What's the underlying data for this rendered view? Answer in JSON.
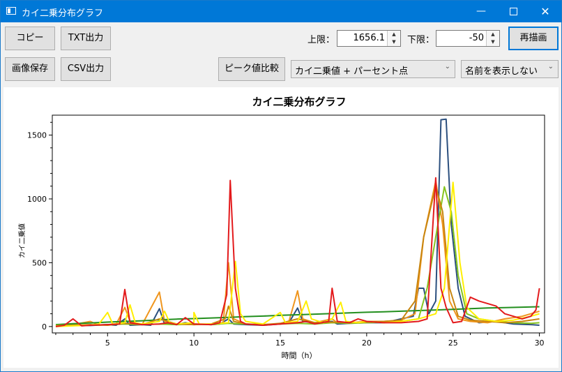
{
  "window": {
    "title": "カイ二乗分布グラフ",
    "minimize_glyph": "—",
    "close_glyph": "✕"
  },
  "toolbar": {
    "copy_label": "コピー",
    "txt_label": "TXT出力",
    "save_image_label": "画像保存",
    "csv_label": "CSV出力",
    "peak_compare_label": "ピーク値比較",
    "upper_label": "上限：",
    "upper_value": "1656.1",
    "lower_label": "下限：",
    "lower_value": "-50",
    "redraw_label": "再描画",
    "mode_select": "カイ二乗値 + パーセント点",
    "name_select": "名前を表示しない"
  },
  "colors": {
    "red": "#e31a1c",
    "orange": "#f0961e",
    "navy": "#2b4f7e",
    "yellow": "#ffef00",
    "green": "#238f1e",
    "darkorange": "#c8850f",
    "line_lime": "#86c41f",
    "accent": "#0078d7"
  },
  "chart_data": {
    "type": "line",
    "title": "カイ二乗分布グラフ",
    "xlabel": "時間（h）",
    "ylabel": "カイ二乗値",
    "xlim": [
      1.8,
      30.3
    ],
    "ylim": [
      -50,
      1656.1
    ],
    "xticks": [
      5,
      10,
      15,
      20,
      25,
      30
    ],
    "yticks": [
      0,
      500,
      1000,
      1500
    ],
    "xtick_labels": [
      "5",
      "10",
      "15",
      "20",
      "25",
      "30"
    ],
    "ytick_labels": [
      "0",
      "500",
      "1000",
      "1500"
    ],
    "legend": "none",
    "grid": false,
    "series": [
      {
        "color": "#2b4f7e",
        "points": [
          [
            2,
            5
          ],
          [
            3,
            10
          ],
          [
            4,
            8
          ],
          [
            5,
            15
          ],
          [
            5.5,
            10
          ],
          [
            6,
            60
          ],
          [
            6.3,
            10
          ],
          [
            7,
            15
          ],
          [
            7.5,
            10
          ],
          [
            8,
            140
          ],
          [
            8.3,
            20
          ],
          [
            9,
            15
          ],
          [
            9.5,
            30
          ],
          [
            10,
            20
          ],
          [
            11,
            15
          ],
          [
            11.5,
            20
          ],
          [
            12,
            60
          ],
          [
            12.3,
            20
          ],
          [
            13,
            15
          ],
          [
            14,
            10
          ],
          [
            15,
            20
          ],
          [
            15.5,
            30
          ],
          [
            16,
            145
          ],
          [
            16.3,
            40
          ],
          [
            17,
            30
          ],
          [
            18,
            40
          ],
          [
            18.3,
            20
          ],
          [
            19,
            25
          ],
          [
            20,
            30
          ],
          [
            21,
            30
          ],
          [
            22,
            60
          ],
          [
            22.7,
            80
          ],
          [
            23,
            300
          ],
          [
            23.3,
            300
          ],
          [
            23.6,
            100
          ],
          [
            24,
            200
          ],
          [
            24.3,
            1620
          ],
          [
            24.6,
            1625
          ],
          [
            24.9,
            800
          ],
          [
            25.3,
            300
          ],
          [
            25.7,
            80
          ],
          [
            26.5,
            30
          ],
          [
            27.5,
            40
          ],
          [
            28.5,
            20
          ],
          [
            29.5,
            15
          ],
          [
            30,
            10
          ]
        ]
      },
      {
        "color": "#f0961e",
        "points": [
          [
            2,
            5
          ],
          [
            3,
            15
          ],
          [
            4,
            40
          ],
          [
            4.5,
            10
          ],
          [
            5,
            15
          ],
          [
            5.5,
            20
          ],
          [
            6,
            150
          ],
          [
            6.3,
            40
          ],
          [
            7,
            15
          ],
          [
            8,
            270
          ],
          [
            8.3,
            40
          ],
          [
            9,
            20
          ],
          [
            10,
            15
          ],
          [
            11,
            20
          ],
          [
            11.7,
            30
          ],
          [
            12,
            500
          ],
          [
            12.3,
            60
          ],
          [
            13,
            20
          ],
          [
            14,
            15
          ],
          [
            15,
            20
          ],
          [
            15.5,
            40
          ],
          [
            16,
            280
          ],
          [
            16.3,
            60
          ],
          [
            17,
            30
          ],
          [
            18,
            60
          ],
          [
            18.3,
            30
          ],
          [
            19,
            30
          ],
          [
            20,
            40
          ],
          [
            21,
            40
          ],
          [
            22,
            50
          ],
          [
            22.8,
            100
          ],
          [
            23.3,
            700
          ],
          [
            24,
            1140
          ],
          [
            24.4,
            800
          ],
          [
            24.8,
            200
          ],
          [
            25.3,
            60
          ],
          [
            26,
            40
          ],
          [
            27,
            30
          ],
          [
            28,
            60
          ],
          [
            29,
            80
          ],
          [
            30,
            120
          ]
        ]
      },
      {
        "color": "#238f1e",
        "points": [
          [
            2,
            15
          ],
          [
            3,
            22
          ],
          [
            4,
            28
          ],
          [
            5,
            35
          ],
          [
            6,
            40
          ],
          [
            7,
            45
          ],
          [
            8,
            52
          ],
          [
            9,
            58
          ],
          [
            10,
            62
          ],
          [
            11,
            67
          ],
          [
            12,
            72
          ],
          [
            13,
            78
          ],
          [
            14,
            82
          ],
          [
            15,
            88
          ],
          [
            16,
            92
          ],
          [
            17,
            97
          ],
          [
            18,
            102
          ],
          [
            19,
            107
          ],
          [
            20,
            112
          ],
          [
            21,
            115
          ],
          [
            22,
            120
          ],
          [
            23,
            125
          ],
          [
            24,
            130
          ],
          [
            25,
            135
          ],
          [
            26,
            140
          ],
          [
            27,
            145
          ],
          [
            28,
            148
          ],
          [
            29,
            152
          ],
          [
            30,
            155
          ]
        ]
      },
      {
        "color": "#86c41f",
        "points": [
          [
            2,
            10
          ],
          [
            3,
            12
          ],
          [
            4,
            10
          ],
          [
            5,
            15
          ],
          [
            6,
            20
          ],
          [
            7,
            15
          ],
          [
            8,
            20
          ],
          [
            9,
            15
          ],
          [
            10,
            20
          ],
          [
            11,
            15
          ],
          [
            12,
            25
          ],
          [
            13,
            20
          ],
          [
            14,
            15
          ],
          [
            15,
            20
          ],
          [
            16,
            25
          ],
          [
            17,
            20
          ],
          [
            18,
            30
          ],
          [
            19,
            25
          ],
          [
            20,
            30
          ],
          [
            21,
            35
          ],
          [
            22,
            40
          ],
          [
            23,
            60
          ],
          [
            23.5,
            300
          ],
          [
            24,
            700
          ],
          [
            24.5,
            1095
          ],
          [
            24.9,
            900
          ],
          [
            25.3,
            400
          ],
          [
            25.8,
            100
          ],
          [
            26.5,
            60
          ],
          [
            27.5,
            40
          ],
          [
            28.5,
            30
          ],
          [
            29.5,
            25
          ],
          [
            30,
            30
          ]
        ]
      },
      {
        "color": "#c8850f",
        "points": [
          [
            2,
            5
          ],
          [
            3,
            10
          ],
          [
            4,
            15
          ],
          [
            5,
            10
          ],
          [
            6,
            25
          ],
          [
            7,
            15
          ],
          [
            8,
            60
          ],
          [
            9,
            20
          ],
          [
            10,
            15
          ],
          [
            11,
            20
          ],
          [
            11.8,
            60
          ],
          [
            12,
            160
          ],
          [
            12.3,
            40
          ],
          [
            13,
            20
          ],
          [
            14,
            15
          ],
          [
            15,
            25
          ],
          [
            16,
            60
          ],
          [
            17,
            30
          ],
          [
            18,
            35
          ],
          [
            19,
            30
          ],
          [
            20,
            35
          ],
          [
            21,
            40
          ],
          [
            22,
            50
          ],
          [
            22.8,
            200
          ],
          [
            23.3,
            700
          ],
          [
            24,
            1100
          ],
          [
            24.4,
            900
          ],
          [
            24.8,
            300
          ],
          [
            25.3,
            80
          ],
          [
            26,
            50
          ],
          [
            27,
            40
          ],
          [
            28,
            30
          ],
          [
            29,
            40
          ],
          [
            30,
            60
          ]
        ]
      },
      {
        "color": "#ffef00",
        "points": [
          [
            2,
            0
          ],
          [
            3,
            5
          ],
          [
            4,
            10
          ],
          [
            4.5,
            20
          ],
          [
            5,
            110
          ],
          [
            5.3,
            20
          ],
          [
            6,
            30
          ],
          [
            6.3,
            170
          ],
          [
            6.6,
            30
          ],
          [
            7,
            20
          ],
          [
            8,
            40
          ],
          [
            8.3,
            120
          ],
          [
            8.6,
            30
          ],
          [
            9,
            20
          ],
          [
            10,
            30
          ],
          [
            10,
            110
          ],
          [
            10.3,
            20
          ],
          [
            11,
            20
          ],
          [
            12,
            30
          ],
          [
            12.4,
            510
          ],
          [
            12.7,
            100
          ],
          [
            13,
            40
          ],
          [
            14,
            20
          ],
          [
            15,
            110
          ],
          [
            15.3,
            30
          ],
          [
            16,
            40
          ],
          [
            16.5,
            200
          ],
          [
            16.8,
            60
          ],
          [
            17.5,
            30
          ],
          [
            18,
            60
          ],
          [
            18.5,
            190
          ],
          [
            18.8,
            40
          ],
          [
            19.5,
            30
          ],
          [
            20,
            40
          ],
          [
            21,
            30
          ],
          [
            22,
            40
          ],
          [
            23,
            60
          ],
          [
            24,
            100
          ],
          [
            24.5,
            300
          ],
          [
            25,
            1130
          ],
          [
            25.4,
            500
          ],
          [
            25.8,
            150
          ],
          [
            26.5,
            60
          ],
          [
            27.5,
            40
          ],
          [
            28.5,
            50
          ],
          [
            29.5,
            80
          ],
          [
            30,
            100
          ]
        ]
      },
      {
        "color": "#e31a1c",
        "points": [
          [
            2,
            0
          ],
          [
            2.5,
            10
          ],
          [
            3,
            60
          ],
          [
            3.5,
            5
          ],
          [
            4,
            10
          ],
          [
            5,
            15
          ],
          [
            5.7,
            20
          ],
          [
            6,
            290
          ],
          [
            6.3,
            30
          ],
          [
            7,
            15
          ],
          [
            8,
            20
          ],
          [
            8.5,
            30
          ],
          [
            9,
            15
          ],
          [
            9.5,
            70
          ],
          [
            10,
            20
          ],
          [
            11,
            15
          ],
          [
            11.5,
            30
          ],
          [
            11.9,
            250
          ],
          [
            12.1,
            1145
          ],
          [
            12.4,
            300
          ],
          [
            12.7,
            40
          ],
          [
            13,
            20
          ],
          [
            14,
            10
          ],
          [
            15,
            20
          ],
          [
            16,
            30
          ],
          [
            16.5,
            40
          ],
          [
            17,
            20
          ],
          [
            17.8,
            40
          ],
          [
            18,
            300
          ],
          [
            18.3,
            40
          ],
          [
            19,
            30
          ],
          [
            19.5,
            60
          ],
          [
            20,
            40
          ],
          [
            21,
            30
          ],
          [
            22,
            30
          ],
          [
            23,
            40
          ],
          [
            23.5,
            60
          ],
          [
            24,
            1165
          ],
          [
            24.3,
            300
          ],
          [
            24.6,
            150
          ],
          [
            25,
            30
          ],
          [
            25.5,
            40
          ],
          [
            26,
            230
          ],
          [
            26.5,
            200
          ],
          [
            27,
            180
          ],
          [
            27.5,
            160
          ],
          [
            28,
            100
          ],
          [
            28.5,
            80
          ],
          [
            29,
            60
          ],
          [
            29.5,
            80
          ],
          [
            29.8,
            130
          ],
          [
            30,
            300
          ]
        ]
      }
    ]
  }
}
